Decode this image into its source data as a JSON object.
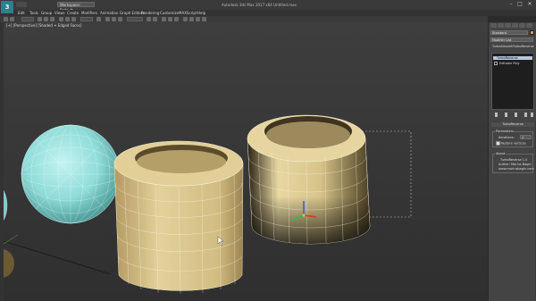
{
  "app": {
    "logo_text": "3",
    "workspace": "Workspace: Default",
    "title": "Autodesk 3ds Max 2017 x64    Untitled.max",
    "window_controls": {
      "minimize": "–",
      "maximize": "□",
      "close": "✕"
    }
  },
  "menu": {
    "items": [
      "Edit",
      "Tools",
      "Group",
      "Views",
      "Create",
      "Modifiers",
      "Animation",
      "Graph Editors",
      "Rendering",
      "Customize",
      "MAXScript",
      "Help"
    ]
  },
  "viewport": {
    "label": "[+] [Perspective] [Shaded + Edged Faces]"
  },
  "command_panel": {
    "object_name": "Standard",
    "modifier_list": "Modifier List",
    "plugin_tabs": [
      "TurboSmooth",
      "TurboReverse"
    ],
    "stack": [
      {
        "label": "TurboReverse",
        "selected": true
      },
      {
        "label": "Editable Poly",
        "selected": false
      }
    ],
    "rollout": {
      "title": "TurboReverse",
      "params_title": "Parameters",
      "iterations_label": "Iterations:",
      "iterations_value": "1",
      "restore_label": "Restore vertices",
      "restore_checked": true,
      "about_title": "About",
      "about_lines": [
        "TurboReverse 1.0",
        "Author: Marius Bagin",
        "www.mariusbagin.com"
      ]
    }
  },
  "colors": {
    "object_color": "#d99a55",
    "sphere_color": "#9be3e1",
    "cylinder_color": "#dccb93"
  }
}
